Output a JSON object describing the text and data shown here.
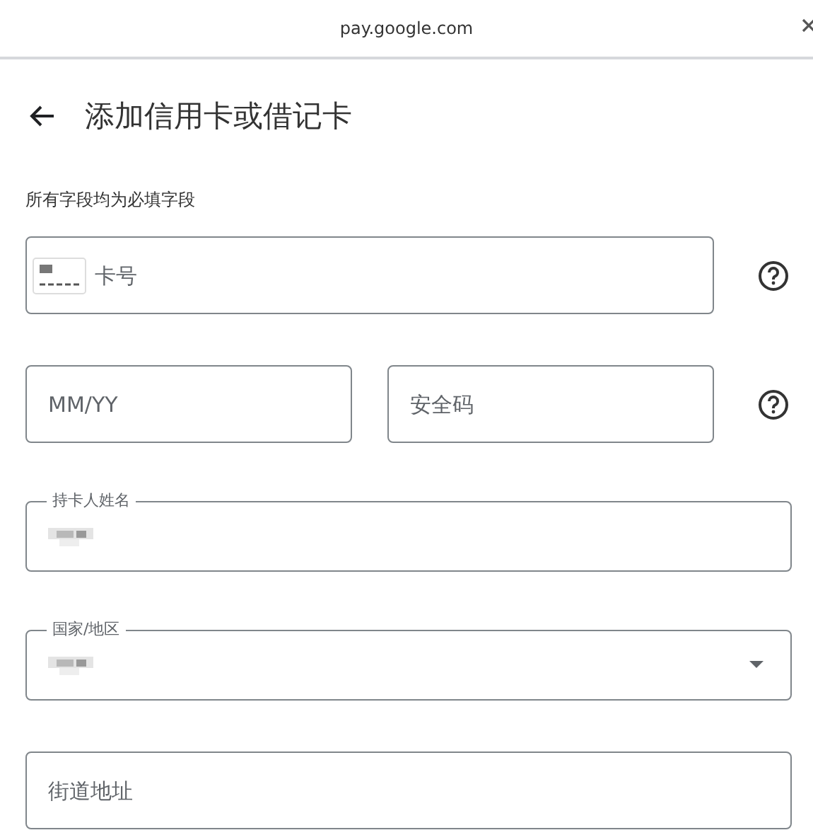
{
  "top_bar": {
    "domain": "pay.google.com"
  },
  "page": {
    "title": "添加信用卡或借记卡",
    "note": "所有字段均为必填字段"
  },
  "rows": [
    {
      "help": true,
      "fields": [
        {
          "kind": "card_number",
          "placeholder": "卡号"
        }
      ]
    },
    {
      "help": true,
      "fields": [
        {
          "kind": "text",
          "placeholder": "MM/YY"
        },
        {
          "kind": "text",
          "placeholder": "安全码"
        }
      ]
    },
    {
      "help": false,
      "fields": [
        {
          "kind": "labeled",
          "label": "持卡人姓名",
          "redacted": true
        }
      ]
    },
    {
      "help": false,
      "fields": [
        {
          "kind": "select",
          "label": "国家/地区",
          "redacted": true
        }
      ]
    },
    {
      "help": false,
      "fields": [
        {
          "kind": "text",
          "placeholder": "街道地址"
        }
      ]
    }
  ]
}
